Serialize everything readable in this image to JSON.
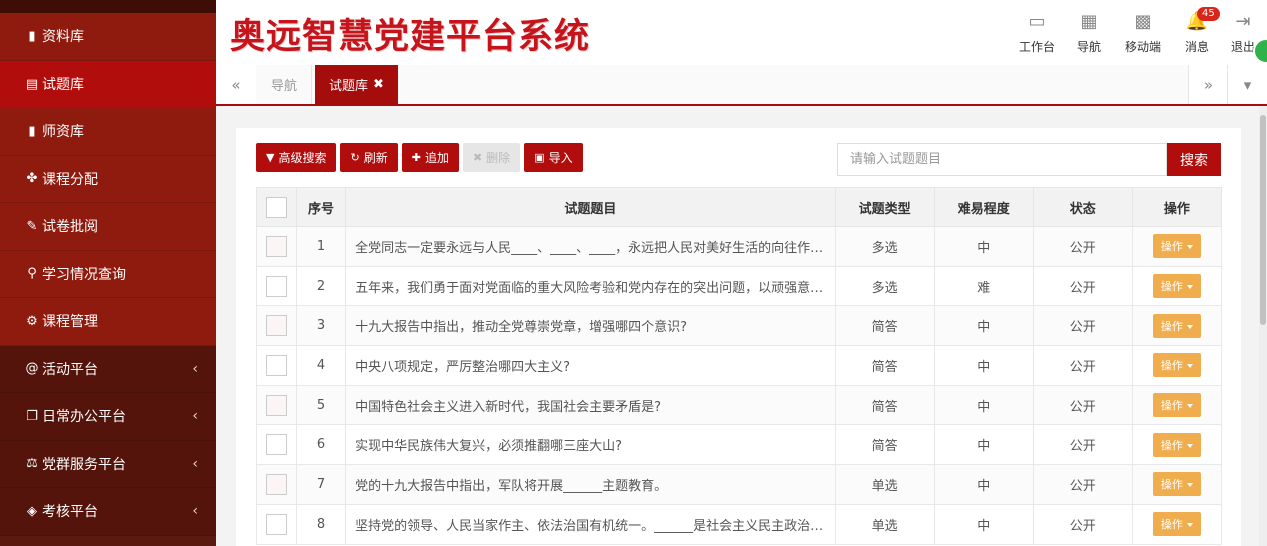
{
  "app": {
    "title": "奥远智慧党建平台系统"
  },
  "sidebar": {
    "items": [
      {
        "label": "资料库",
        "icon": "book-icon",
        "glyph": "▮"
      },
      {
        "label": "试题库",
        "icon": "list-icon",
        "glyph": "▤"
      },
      {
        "label": "师资库",
        "icon": "id-card-icon",
        "glyph": "▮"
      },
      {
        "label": "课程分配",
        "icon": "cubes-icon",
        "glyph": "✤"
      },
      {
        "label": "试卷批阅",
        "icon": "pencil-icon",
        "glyph": "✎"
      },
      {
        "label": "学习情况查询",
        "icon": "search-icon",
        "glyph": "⚲"
      },
      {
        "label": "课程管理",
        "icon": "cogs-icon",
        "glyph": "⚙"
      },
      {
        "label": "活动平台",
        "icon": "at-icon",
        "glyph": "@"
      },
      {
        "label": "日常办公平台",
        "icon": "copy-icon",
        "glyph": "❐"
      },
      {
        "label": "党群服务平台",
        "icon": "balance-icon",
        "glyph": "⚖"
      },
      {
        "label": "考核平台",
        "icon": "diamond-icon",
        "glyph": "◈"
      }
    ]
  },
  "header": {
    "nav": [
      {
        "label": "工作台",
        "icon": "desktop-icon",
        "glyph": "▭"
      },
      {
        "label": "导航",
        "icon": "grid-icon",
        "glyph": "▦"
      },
      {
        "label": "移动端",
        "icon": "qrcode-icon",
        "glyph": "▩"
      },
      {
        "label": "消息",
        "icon": "bell-icon",
        "glyph": "🔔",
        "badge": "45"
      },
      {
        "label": "退出",
        "icon": "sign-out-icon",
        "glyph": "⇥"
      }
    ]
  },
  "tabs": {
    "prev": "«",
    "next": "»",
    "menu": "▾",
    "nav_label": "导航",
    "current_label": "试题库",
    "close": "✖"
  },
  "toolbar": {
    "advanced_search": "高级搜索",
    "refresh": "刷新",
    "add": "追加",
    "delete": "删除",
    "import": "导入"
  },
  "search": {
    "placeholder": "请输入试题题目",
    "button": "搜索"
  },
  "table": {
    "headers": [
      "序号",
      "试题题目",
      "试题类型",
      "难易程度",
      "状态",
      "操作"
    ],
    "rows": [
      {
        "no": "1",
        "q": "全党同志一定要永远与人民____、____、____，永远把人民对美好生活的向往作为奋斗目标",
        "type": "多选",
        "level": "中",
        "status": "公开",
        "op": "操作"
      },
      {
        "no": "2",
        "q": "五年来，我们勇于面对党面临的重大风险考验和党内存在的突出问题，以顽强意志品质正风肃纪",
        "type": "多选",
        "level": "难",
        "status": "公开",
        "op": "操作"
      },
      {
        "no": "3",
        "q": "十九大报告中指出，推动全党尊崇党章，增强哪四个意识?",
        "type": "简答",
        "level": "中",
        "status": "公开",
        "op": "操作"
      },
      {
        "no": "4",
        "q": "中央八项规定，严厉整治哪四大主义?",
        "type": "简答",
        "level": "中",
        "status": "公开",
        "op": "操作"
      },
      {
        "no": "5",
        "q": "中国特色社会主义进入新时代，我国社会主要矛盾是?",
        "type": "简答",
        "level": "中",
        "status": "公开",
        "op": "操作"
      },
      {
        "no": "6",
        "q": "实现中华民族伟大复兴，必须推翻哪三座大山?",
        "type": "简答",
        "level": "中",
        "status": "公开",
        "op": "操作"
      },
      {
        "no": "7",
        "q": "党的十九大报告中指出，军队将开展______主题教育。",
        "type": "单选",
        "level": "中",
        "status": "公开",
        "op": "操作"
      },
      {
        "no": "8",
        "q": "坚持党的领导、人民当家作主、依法治国有机统一。______是社会主义民主政治的本质特征",
        "type": "单选",
        "level": "中",
        "status": "公开",
        "op": "操作"
      }
    ]
  },
  "colors": {
    "brand": "#c5141b",
    "primary": "#b20d0d",
    "warning": "#f0ad4e"
  }
}
